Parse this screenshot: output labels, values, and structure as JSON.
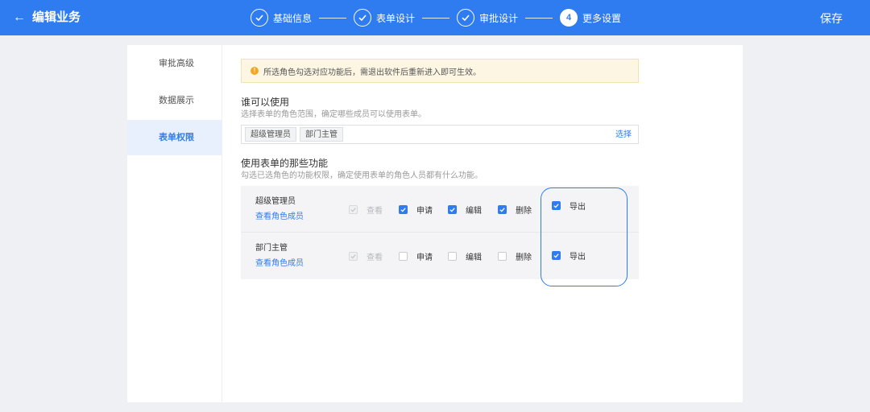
{
  "header": {
    "title": "编辑业务",
    "save_label": "保存",
    "steps": [
      {
        "label": "基础信息",
        "status": "done"
      },
      {
        "label": "表单设计",
        "status": "done"
      },
      {
        "label": "审批设计",
        "status": "done"
      },
      {
        "label": "更多设置",
        "status": "active",
        "number": "4"
      }
    ]
  },
  "sidebar": {
    "items": [
      {
        "label": "审批高级"
      },
      {
        "label": "数据展示"
      },
      {
        "label": "表单权限"
      }
    ]
  },
  "notice": "所选角色勾选对应功能后，需退出软件后重新进入即可生效。",
  "who_can_use": {
    "title": "谁可以使用",
    "desc": "选择表单的角色范围，确定哪些成员可以使用表单。",
    "tags": [
      "超级管理员",
      "部门主管"
    ],
    "select_label": "选择"
  },
  "functions": {
    "title": "使用表单的那些功能",
    "desc": "勾选已选角色的功能权限，确定使用表单的角色人员都有什么功能。",
    "view_members_label": "查看角色成员",
    "perm_labels": {
      "view": "查看",
      "apply": "申请",
      "edit": "编辑",
      "delete": "删除",
      "export": "导出"
    },
    "rows": [
      {
        "role": "超级管理员",
        "view": true,
        "apply": true,
        "edit": true,
        "delete": true,
        "export": true
      },
      {
        "role": "部门主管",
        "view": true,
        "apply": false,
        "edit": false,
        "delete": false,
        "export": true
      }
    ]
  },
  "colors": {
    "primary": "#2f7cf0",
    "warning": "#f5a623"
  }
}
